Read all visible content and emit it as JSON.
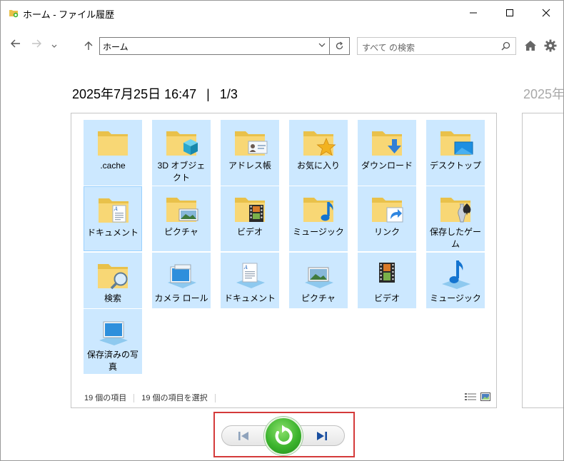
{
  "window": {
    "title": "ホーム - ファイル履歴"
  },
  "nav": {
    "address_value": "ホーム",
    "search_placeholder": "すべて の検索"
  },
  "snapshot": {
    "datetime": "2025年7月25日 16:47",
    "separator": "|",
    "page": "1/3",
    "next_datetime": "2025年"
  },
  "items": [
    {
      "label": ".cache",
      "icon": "folder-icon"
    },
    {
      "label": "3D オブジェクト",
      "icon": "3d-objects-folder-icon"
    },
    {
      "label": "アドレス帳",
      "icon": "contacts-folder-icon"
    },
    {
      "label": "お気に入り",
      "icon": "favorites-folder-icon"
    },
    {
      "label": "ダウンロード",
      "icon": "downloads-folder-icon"
    },
    {
      "label": "デスクトップ",
      "icon": "desktop-folder-icon"
    },
    {
      "label": "ドキュメント",
      "icon": "documents-folder-icon"
    },
    {
      "label": "ピクチャ",
      "icon": "pictures-folder-icon"
    },
    {
      "label": "ビデオ",
      "icon": "videos-folder-icon"
    },
    {
      "label": "ミュージック",
      "icon": "music-folder-icon"
    },
    {
      "label": "リンク",
      "icon": "links-folder-icon"
    },
    {
      "label": "保存したゲーム",
      "icon": "saved-games-folder-icon"
    },
    {
      "label": "検索",
      "icon": "searches-folder-icon"
    },
    {
      "label": "カメラ ロール",
      "icon": "camera-roll-library-icon"
    },
    {
      "label": "ドキュメント",
      "icon": "documents-library-icon"
    },
    {
      "label": "ピクチャ",
      "icon": "pictures-library-icon"
    },
    {
      "label": "ビデオ",
      "icon": "videos-library-icon"
    },
    {
      "label": "ミュージック",
      "icon": "music-library-icon"
    },
    {
      "label": "保存済みの写真",
      "icon": "saved-pictures-library-icon"
    }
  ],
  "status": {
    "count": "19 個の項目",
    "selected": "19 個の項目を選択"
  },
  "colors": {
    "selection": "#cce8ff",
    "restore_green": "#3cb42e",
    "highlight_box": "#d43a3a",
    "nav_blue": "#1a4fa0"
  }
}
